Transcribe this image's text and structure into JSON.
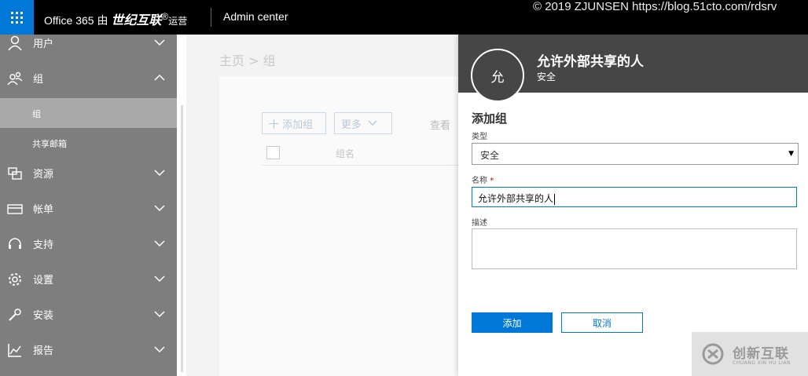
{
  "watermark_top": "© 2019 ZJUNSEN https://blog.51cto.com/rdsrv",
  "topbar": {
    "brand_prefix": "Office 365 由",
    "brand_partner": "世纪互联",
    "brand_reg": "®",
    "brand_suffix": "运营",
    "app_name": "Admin center"
  },
  "sidebar": {
    "items": [
      {
        "label": "用户",
        "icon": "user-icon"
      },
      {
        "label": "组",
        "icon": "group-icon"
      },
      {
        "label": "组",
        "icon": ""
      },
      {
        "label": "共享邮箱",
        "icon": ""
      },
      {
        "label": "资源",
        "icon": "resources-icon"
      },
      {
        "label": "帐单",
        "icon": "billing-icon"
      },
      {
        "label": "支持",
        "icon": "headset-icon"
      },
      {
        "label": "设置",
        "icon": "gear-icon"
      },
      {
        "label": "安装",
        "icon": "wrench-icon"
      },
      {
        "label": "报告",
        "icon": "chart-icon"
      }
    ]
  },
  "main": {
    "breadcrumb": "主页 > 组",
    "add_group": "十 添加组",
    "more": "更多",
    "view": "查看",
    "col_name": "组名"
  },
  "panel": {
    "avatar_letter": "允",
    "title": "允许外部共享的人",
    "subtitle": "安全",
    "section_title": "添加组",
    "type_label": "类型",
    "type_value": "安全",
    "name_label": "名称",
    "name_required": "*",
    "name_value": "允许外部共享的人",
    "desc_label": "描述",
    "desc_value": "",
    "add_button": "添加",
    "cancel_button": "取消"
  },
  "watermark": {
    "name": "创新互联",
    "sub": "CHUANG XIN HU LIAN"
  },
  "colors": {
    "accent": "#0078d7",
    "sidebar": "#7e7e7e",
    "panel_header": "#464646"
  }
}
